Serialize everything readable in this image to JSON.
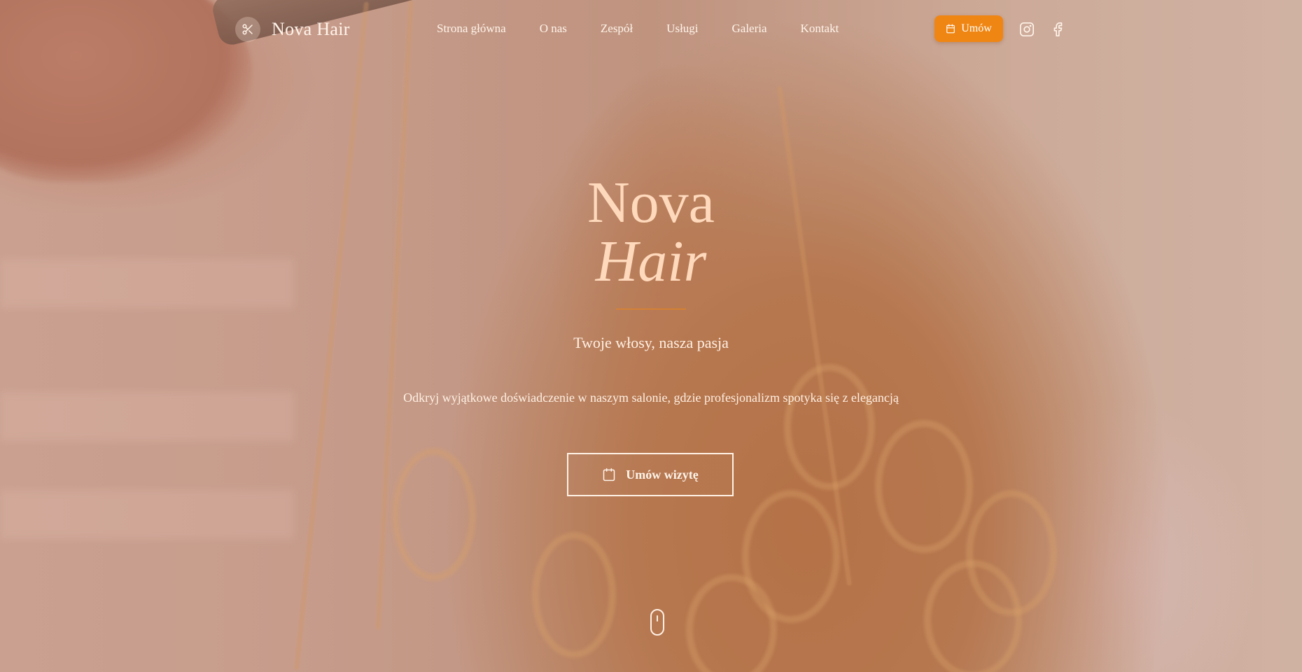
{
  "brand": {
    "name": "Nova Hair",
    "icon": "scissors-icon"
  },
  "nav": {
    "items": [
      {
        "label": "Strona główna"
      },
      {
        "label": "O nas"
      },
      {
        "label": "Zespół"
      },
      {
        "label": "Usługi"
      },
      {
        "label": "Galeria"
      },
      {
        "label": "Kontakt"
      }
    ],
    "cta_label": "Umów",
    "cta_icon": "calendar-icon",
    "social": [
      "instagram-icon",
      "facebook-icon"
    ]
  },
  "hero": {
    "title_line_1": "Nova",
    "title_line_2": "Hair",
    "tagline": "Twoje włosy, nasza pasja",
    "description": "Odkryj wyjątkowe doświadczenie w naszym salonie, gdzie profesjonalizm spotyka się z elegancją",
    "cta_label": "Umów wizytę",
    "cta_icon": "calendar-icon"
  },
  "colors": {
    "accent": "#ef8614",
    "title": "#ffd9bc",
    "text": "#fff4ea"
  }
}
